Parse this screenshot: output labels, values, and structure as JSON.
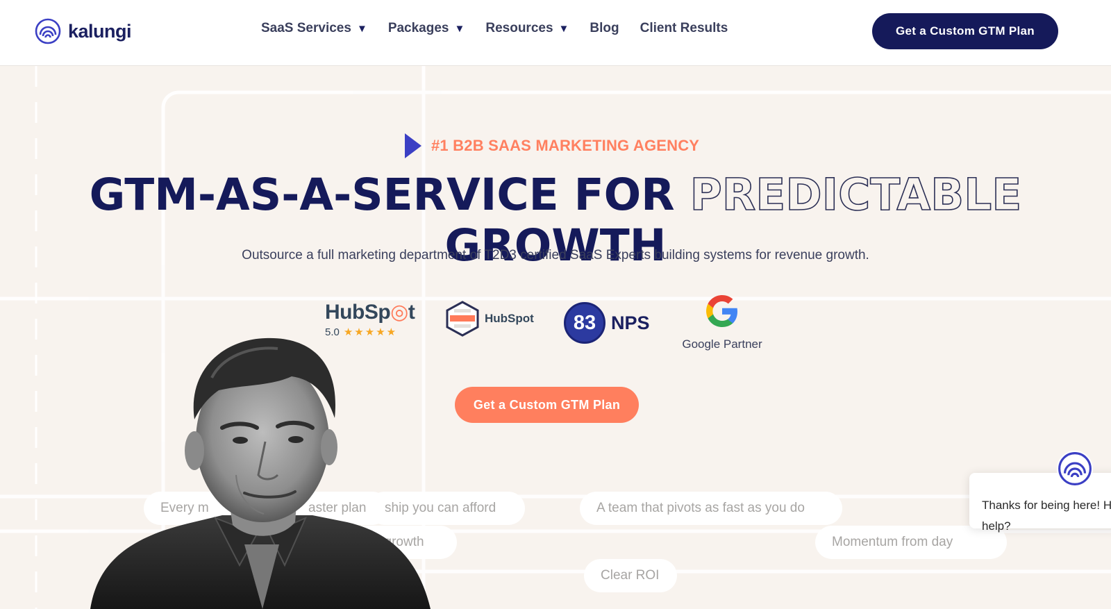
{
  "header": {
    "brand": "kalungi",
    "nav": [
      {
        "label": "SaaS Services",
        "dropdown": true
      },
      {
        "label": "Packages",
        "dropdown": true
      },
      {
        "label": "Resources",
        "dropdown": true
      },
      {
        "label": "Blog",
        "dropdown": false
      },
      {
        "label": "Client Results",
        "dropdown": false
      }
    ],
    "cta_label": "Get a Custom GTM Plan"
  },
  "hero": {
    "eyebrow": "#1 B2B SAAS MARKETING AGENCY",
    "headline_part1": "GTM-AS-A-SERVICE FOR ",
    "headline_outline": "PREDICTABLE",
    "headline_part2": " GROWTH",
    "subtitle": "Outsource a full marketing department of T2D3 certified SaaS Experts building systems for revenue growth.",
    "cta_label": "Get a Custom GTM Plan"
  },
  "badges": {
    "hubspot_word_a": "HubSp",
    "hubspot_word_b": "t",
    "hubspot_rating": "5.0",
    "hubspot_stars": "★★★★★",
    "diamond_partner": "HubSpot",
    "nps_score": "83",
    "nps_label": "NPS",
    "google_label": "Google Partner"
  },
  "pills": [
    {
      "text": "Every m"
    },
    {
      "text": "aster plan"
    },
    {
      "text": "ship you can afford"
    },
    {
      "text": "A team that pivots as fast as you do"
    },
    {
      "text": "ty for growth"
    },
    {
      "text": "Momentum from day"
    },
    {
      "text": "Clear ROI"
    }
  ],
  "chat": {
    "message_line1": "Thanks for being here! H",
    "message_line2": "help?"
  },
  "colors": {
    "navy": "#151a5a",
    "coral": "#ff7f5e",
    "background": "#f8f3ee",
    "indigo": "#3b3fc4"
  }
}
